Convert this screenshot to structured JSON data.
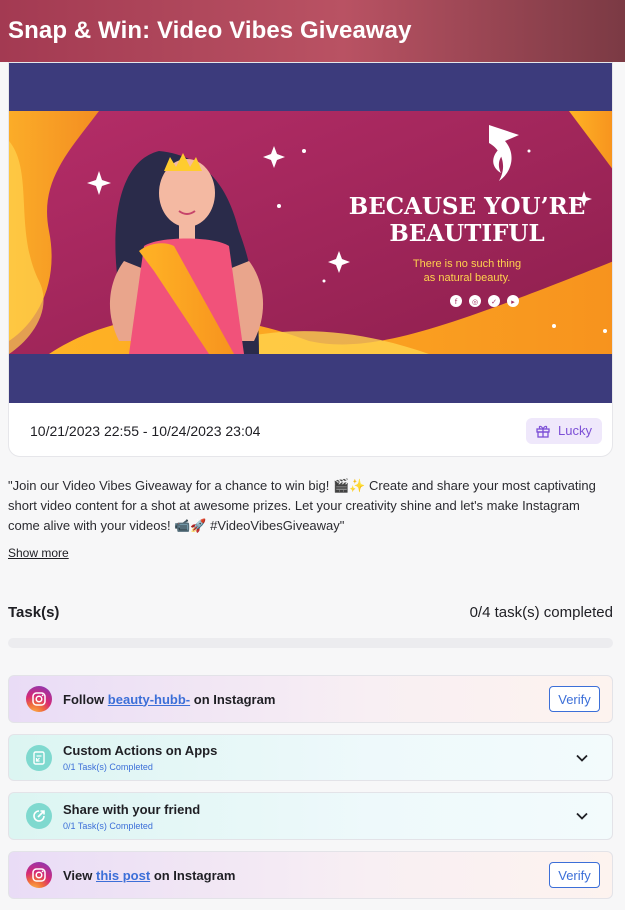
{
  "header": {
    "title": "Snap & Win: Video Vibes Giveaway"
  },
  "banner": {
    "headline_line1": "BECAUSE YOU’RE",
    "headline_line2": "BEAUTIFUL",
    "tagline_line1": "There is no such thing",
    "tagline_line2": "as natural beauty.",
    "social_icons": [
      "facebook-icon",
      "instagram-icon",
      "twitter-icon",
      "youtube-icon"
    ]
  },
  "event": {
    "date_range": "10/21/2023 22:55 - 10/24/2023 23:04",
    "badge_label": "Lucky",
    "badge_icon": "gift-icon"
  },
  "description": {
    "text": "\"Join our Video Vibes Giveaway for a chance to win big! 🎬✨ Create and share your most captivating short video content for a shot at awesome prizes. Let your creativity shine and let's make Instagram come alive with your videos! 📹🚀 #VideoVibesGiveaway\"",
    "show_more": "Show more"
  },
  "tasks": {
    "title": "Task(s)",
    "completed_text": "0/4 task(s) completed",
    "progress": 0,
    "items": [
      {
        "prefix": "Follow",
        "link": "beauty-hubb-",
        "suffix": "on Instagram",
        "action": "Verify",
        "icon": "instagram-icon"
      },
      {
        "label": "Custom Actions on Apps",
        "sub": "0/1 Task(s) Completed",
        "icon": "apps-icon"
      },
      {
        "label": "Share with your friend",
        "sub": "0/1 Task(s) Completed",
        "icon": "share-icon"
      },
      {
        "prefix": "View",
        "link": "this post",
        "suffix": "on Instagram",
        "action": "Verify",
        "icon": "instagram-icon"
      }
    ]
  },
  "colors": {
    "accent": "#7c4fd6",
    "link": "#3c6fd8",
    "banner_bg": "#3c3b7c"
  }
}
